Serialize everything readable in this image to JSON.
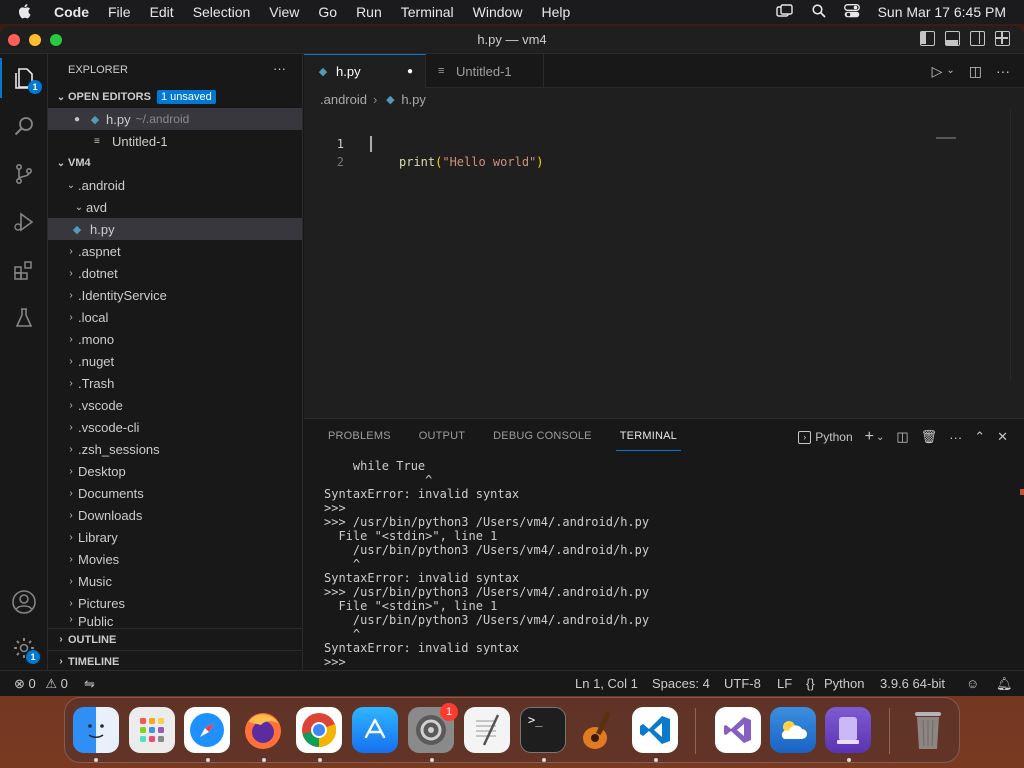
{
  "menubar": {
    "app": "Code",
    "items": [
      "File",
      "Edit",
      "Selection",
      "View",
      "Go",
      "Run",
      "Terminal",
      "Window",
      "Help"
    ],
    "clock": "Sun Mar 17  6:45 PM"
  },
  "window": {
    "title": "h.py — vm4"
  },
  "activity": {
    "explorer_badge": "1",
    "settings_badge": "1"
  },
  "sidebar": {
    "title": "EXPLORER",
    "more": "···",
    "open_editors": "OPEN EDITORS",
    "unsaved": "1 unsaved",
    "open_files": [
      {
        "name": "h.py",
        "path": "~/.android"
      },
      {
        "name": "Untitled-1"
      }
    ],
    "root": "VM4",
    "tree": [
      ".android",
      "avd",
      "h.py",
      ".aspnet",
      ".dotnet",
      ".IdentityService",
      ".local",
      ".mono",
      ".nuget",
      ".Trash",
      ".vscode",
      ".vscode-cli",
      ".zsh_sessions",
      "Desktop",
      "Documents",
      "Downloads",
      "Library",
      "Movies",
      "Music",
      "Pictures",
      "Public"
    ],
    "outline": "OUTLINE",
    "timeline": "TIMELINE"
  },
  "editor": {
    "tabs": [
      {
        "label": "h.py",
        "dirty": "●"
      },
      {
        "label": "Untitled-1"
      }
    ],
    "breadcrumb": [
      ".android",
      "h.py"
    ],
    "lines": [
      "1",
      "2"
    ],
    "code": {
      "fn": "print",
      "open": "(",
      "str": "\"Hello world\"",
      "close": ")"
    }
  },
  "panel": {
    "tabs": [
      "PROBLEMS",
      "OUTPUT",
      "DEBUG CONSOLE",
      "TERMINAL"
    ],
    "shell": "Python",
    "terminal": "    while True\n              ^\nSyntaxError: invalid syntax\n>>>\n>>> /usr/bin/python3 /Users/vm4/.android/h.py\n  File \"<stdin>\", line 1\n    /usr/bin/python3 /Users/vm4/.android/h.py\n    ^\nSyntaxError: invalid syntax\n>>> /usr/bin/python3 /Users/vm4/.android/h.py\n  File \"<stdin>\", line 1\n    /usr/bin/python3 /Users/vm4/.android/h.py\n    ^\nSyntaxError: invalid syntax\n>>>"
  },
  "statusbar": {
    "errors": "0",
    "warnings": "0",
    "position": "Ln 1, Col 1",
    "spaces": "Spaces: 4",
    "encoding": "UTF-8",
    "eol": "LF",
    "language": "Python",
    "interpreter": "3.9.6 64-bit"
  },
  "dock": {
    "settings_badge": "1",
    "apps": [
      "finder",
      "launchpad",
      "safari",
      "firefox",
      "chrome",
      "app-store",
      "system-settings",
      "textedit",
      "terminal",
      "garageband",
      "vscode",
      "visual-studio",
      "weather",
      "simulator",
      "trash"
    ]
  },
  "colors": {
    "accent": "#0078d4",
    "string": "#ce9178",
    "function": "#dcdcaa"
  }
}
